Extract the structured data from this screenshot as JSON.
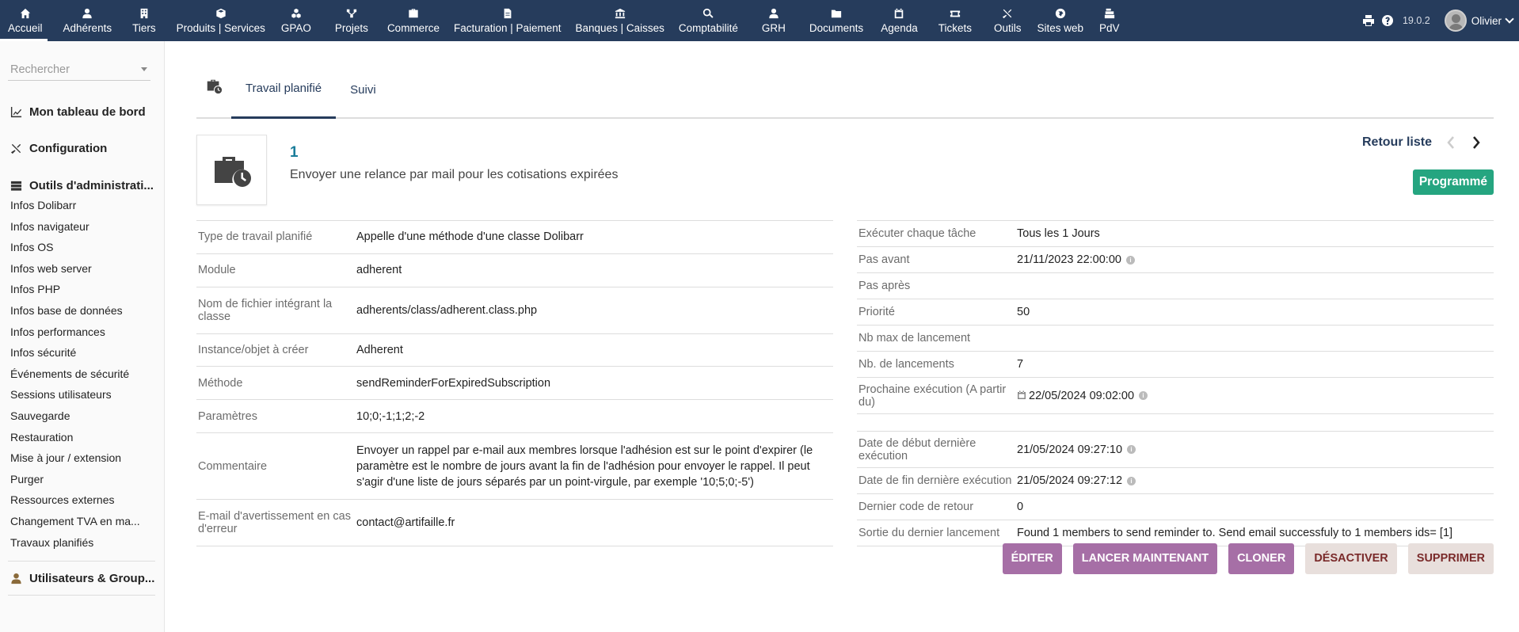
{
  "topbar": {
    "menu": [
      {
        "label": "Accueil",
        "icon": "home-icon",
        "active": true
      },
      {
        "label": "Adhérents",
        "icon": "user-icon"
      },
      {
        "label": "Tiers",
        "icon": "building-icon"
      },
      {
        "label": "Produits | Services",
        "icon": "cube-icon"
      },
      {
        "label": "GPAO",
        "icon": "cubes-icon"
      },
      {
        "label": "Projets",
        "icon": "project-icon"
      },
      {
        "label": "Commerce",
        "icon": "suitcase-icon"
      },
      {
        "label": "Facturation | Paiement",
        "icon": "invoice-icon"
      },
      {
        "label": "Banques | Caisses",
        "icon": "bank-icon"
      },
      {
        "label": "Comptabilité",
        "icon": "search-dollar-icon"
      },
      {
        "label": "GRH",
        "icon": "user-tie-icon"
      },
      {
        "label": "Documents",
        "icon": "folder-icon"
      },
      {
        "label": "Agenda",
        "icon": "calendar-icon"
      },
      {
        "label": "Tickets",
        "icon": "ticket-icon"
      },
      {
        "label": "Outils",
        "icon": "tools-icon"
      },
      {
        "label": "Sites web",
        "icon": "globe-icon"
      },
      {
        "label": "PdV",
        "icon": "cash-register-icon"
      }
    ],
    "version": "19.0.2",
    "user": "Olivier"
  },
  "sidebar": {
    "search_placeholder": "Rechercher",
    "dashboard": "Mon tableau de bord",
    "configuration": "Configuration",
    "admin_tools": "Outils d'administrati...",
    "links": [
      "Infos Dolibarr",
      "Infos navigateur",
      "Infos OS",
      "Infos web server",
      "Infos PHP",
      "Infos base de données",
      "Infos performances",
      "Infos sécurité",
      "Événements de sécurité",
      "Sessions utilisateurs",
      "Sauvegarde",
      "Restauration",
      "Mise à jour / extension",
      "Purger",
      "Ressources externes",
      "Changement TVA en ma...",
      "Travaux planifiés"
    ],
    "users_groups": "Utilisateurs & Group..."
  },
  "tabs": [
    {
      "label": "Travail planifié",
      "active": true
    },
    {
      "label": "Suivi"
    }
  ],
  "job": {
    "ref": "1",
    "label": "Envoyer une relance par mail pour les cotisations expirées",
    "back_to_list": "Retour liste",
    "status": "Programmé",
    "status_color": "#25a580"
  },
  "left_fields": [
    {
      "label": "Type de travail planifié",
      "value": "Appelle d'une méthode d'une classe Dolibarr"
    },
    {
      "label": "Module",
      "value": "adherent"
    },
    {
      "label": "Nom de fichier intégrant la classe",
      "value": "adherents/class/adherent.class.php"
    },
    {
      "label": "Instance/objet à créer",
      "value": "Adherent"
    },
    {
      "label": "Méthode",
      "value": "sendReminderForExpiredSubscription"
    },
    {
      "label": "Paramètres",
      "value": "10;0;-1;1;2;-2"
    },
    {
      "label": "Commentaire",
      "value": "Envoyer un rappel par e-mail aux membres lorsque l'adhésion est sur le point d'expirer (le paramètre est le nombre de jours avant la fin de l'adhésion pour envoyer le rappel. Il peut s'agir d'une liste de jours séparés par un point-virgule, par exemple '10;5;0;-5')"
    },
    {
      "label": "E-mail d'avertissement en cas d'erreur",
      "value": "contact@artifaille.fr"
    }
  ],
  "right_fields": [
    {
      "label": "Exécuter chaque tâche",
      "value": "Tous les 1 Jours"
    },
    {
      "label": "Pas avant",
      "value": "21/11/2023 22:00:00"
    },
    {
      "label": "Pas après",
      "value": ""
    },
    {
      "label": "Priorité",
      "value": "50"
    },
    {
      "label": "Nb max de lancement",
      "value": ""
    },
    {
      "label": "Nb. de lancements",
      "value": "7"
    },
    {
      "label": "Prochaine exécution (A partir du)",
      "value": "22/05/2024 09:02:00"
    }
  ],
  "right_fields2": [
    {
      "label": "Date de début dernière exécution",
      "value": "21/05/2024 09:27:10"
    },
    {
      "label": "Date de fin dernière exécution",
      "value": "21/05/2024 09:27:12"
    },
    {
      "label": "Dernier code de retour",
      "value": "0"
    },
    {
      "label": "Sortie du dernier lancement",
      "value": "Found 1 members to send reminder to. Send email successfuly to 1 members ids= [1]"
    }
  ],
  "actions": {
    "edit": "ÉDITER",
    "run_now": "LANCER MAINTENANT",
    "clone": "CLONER",
    "disable": "DÉSACTIVER",
    "delete": "SUPPRIMER"
  }
}
